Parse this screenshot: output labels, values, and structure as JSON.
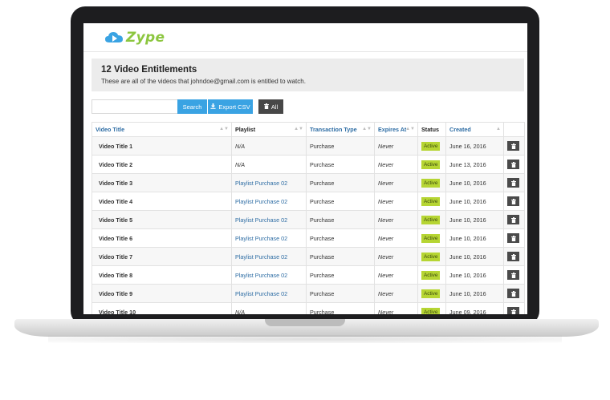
{
  "app": {
    "logo_text": "Zype"
  },
  "header": {
    "title": "12 Video Entitlements",
    "subtitle": "These are all of the videos that johndoe@gmail.com is entitled to watch."
  },
  "toolbar": {
    "search_value": "",
    "search_label": "Search",
    "export_label": "Export CSV",
    "all_label": "All"
  },
  "table": {
    "columns": {
      "video_title": "Video Title",
      "playlist": "Playlist",
      "transaction_type": "Transaction Type",
      "expires_at": "Expires At",
      "status": "Status",
      "created": "Created"
    },
    "rows": [
      {
        "title": "Video Title 1",
        "playlist": "N/A",
        "transaction": "Purchase",
        "expires": "Never",
        "status": "Active",
        "created": "June 16, 2016"
      },
      {
        "title": "Video Title 2",
        "playlist": "N/A",
        "transaction": "Purchase",
        "expires": "Never",
        "status": "Active",
        "created": "June 13, 2016"
      },
      {
        "title": "Video Title 3",
        "playlist": "Playlist Purchase 02",
        "transaction": "Purchase",
        "expires": "Never",
        "status": "Active",
        "created": "June 10, 2016"
      },
      {
        "title": "Video Title 4",
        "playlist": "Playlist Purchase 02",
        "transaction": "Purchase",
        "expires": "Never",
        "status": "Active",
        "created": "June 10, 2016"
      },
      {
        "title": "Video Title 5",
        "playlist": "Playlist Purchase 02",
        "transaction": "Purchase",
        "expires": "Never",
        "status": "Active",
        "created": "June 10, 2016"
      },
      {
        "title": "Video Title 6",
        "playlist": "Playlist Purchase 02",
        "transaction": "Purchase",
        "expires": "Never",
        "status": "Active",
        "created": "June 10, 2016"
      },
      {
        "title": "Video Title 7",
        "playlist": "Playlist Purchase 02",
        "transaction": "Purchase",
        "expires": "Never",
        "status": "Active",
        "created": "June 10, 2016"
      },
      {
        "title": "Video Title 8",
        "playlist": "Playlist Purchase 02",
        "transaction": "Purchase",
        "expires": "Never",
        "status": "Active",
        "created": "June 10, 2016"
      },
      {
        "title": "Video Title 9",
        "playlist": "Playlist Purchase 02",
        "transaction": "Purchase",
        "expires": "Never",
        "status": "Active",
        "created": "June 10, 2016"
      },
      {
        "title": "Video Title 10",
        "playlist": "N/A",
        "transaction": "Purchase",
        "expires": "Never",
        "status": "Active",
        "created": "June 09, 2016"
      }
    ]
  },
  "colors": {
    "accent": "#3aa3e3",
    "brand": "#8cc63f",
    "status_active": "#b6d533",
    "link": "#2e6da4",
    "dark_button": "#474747"
  },
  "icons": {
    "logo": "cloud-play-icon",
    "export": "download-icon",
    "all": "trash-icon",
    "row_action": "trash-icon",
    "sort": "sort-icon"
  }
}
